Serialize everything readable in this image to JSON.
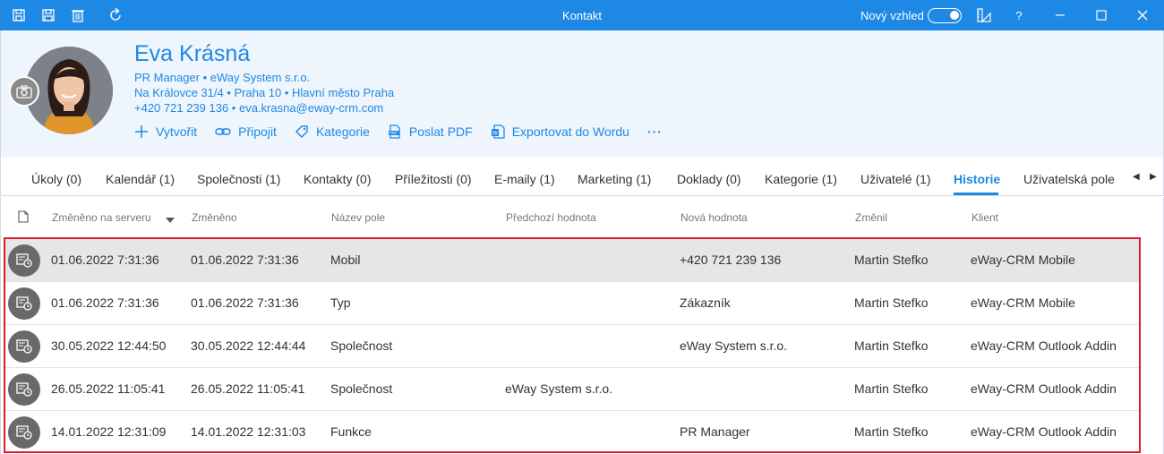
{
  "window": {
    "title": "Kontakt",
    "new_look_label": "Nový vzhled",
    "help": "?"
  },
  "contact": {
    "name": "Eva Krásná",
    "position_line": "PR Manager • eWay System s.r.o.",
    "address_line": "Na Královce 31/4 • Praha 10 • Hlavní město Praha",
    "contact_line": "+420 721 239 136 • eva.krasna@eway-crm.com"
  },
  "actions": {
    "create": "Vytvořit",
    "connect": "Připojit",
    "category": "Kategorie",
    "send_pdf": "Poslat PDF",
    "export_word": "Exportovat do Wordu",
    "more": "···"
  },
  "tabs": [
    "Úkoly (0)",
    "Kalendář (1)",
    "Společnosti (1)",
    "Kontakty (0)",
    "Příležitosti (0)",
    "E-maily (1)",
    "Marketing (1)",
    "Doklady (0)",
    "Kategorie (1)",
    "Uživatelé (1)",
    "Historie",
    "Uživatelská pole"
  ],
  "grid": {
    "columns": {
      "changed_server": "Změněno na serveru",
      "changed": "Změněno",
      "field": "Název pole",
      "previous": "Předchozí hodnota",
      "new_value": "Nová hodnota",
      "changed_by": "Změnil",
      "client": "Klient"
    },
    "rows": [
      {
        "server": "01.06.2022 7:31:36",
        "changed": "01.06.2022 7:31:36",
        "field": "Mobil",
        "previous": "",
        "new_value": "+420 721 239 136",
        "by": "Martin Stefko",
        "client": "eWay-CRM Mobile"
      },
      {
        "server": "01.06.2022 7:31:36",
        "changed": "01.06.2022 7:31:36",
        "field": "Typ",
        "previous": "",
        "new_value": "Zákazník",
        "by": "Martin Stefko",
        "client": "eWay-CRM Mobile"
      },
      {
        "server": "30.05.2022 12:44:50",
        "changed": "30.05.2022 12:44:44",
        "field": "Společnost",
        "previous": "",
        "new_value": "eWay System s.r.o.",
        "by": "Martin Stefko",
        "client": "eWay-CRM Outlook Addin"
      },
      {
        "server": "26.05.2022 11:05:41",
        "changed": "26.05.2022 11:05:41",
        "field": "Společnost",
        "previous": "eWay System s.r.o.",
        "new_value": "",
        "by": "Martin Stefko",
        "client": "eWay-CRM Outlook Addin"
      },
      {
        "server": "14.01.2022 12:31:09",
        "changed": "14.01.2022 12:31:03",
        "field": "Funkce",
        "previous": "",
        "new_value": "PR Manager",
        "by": "Martin Stefko",
        "client": "eWay-CRM Outlook Addin"
      }
    ]
  },
  "colors": {
    "accent": "#1e88e5",
    "highlight_border": "#e0192b",
    "selected_row": "#e6e6e6"
  }
}
